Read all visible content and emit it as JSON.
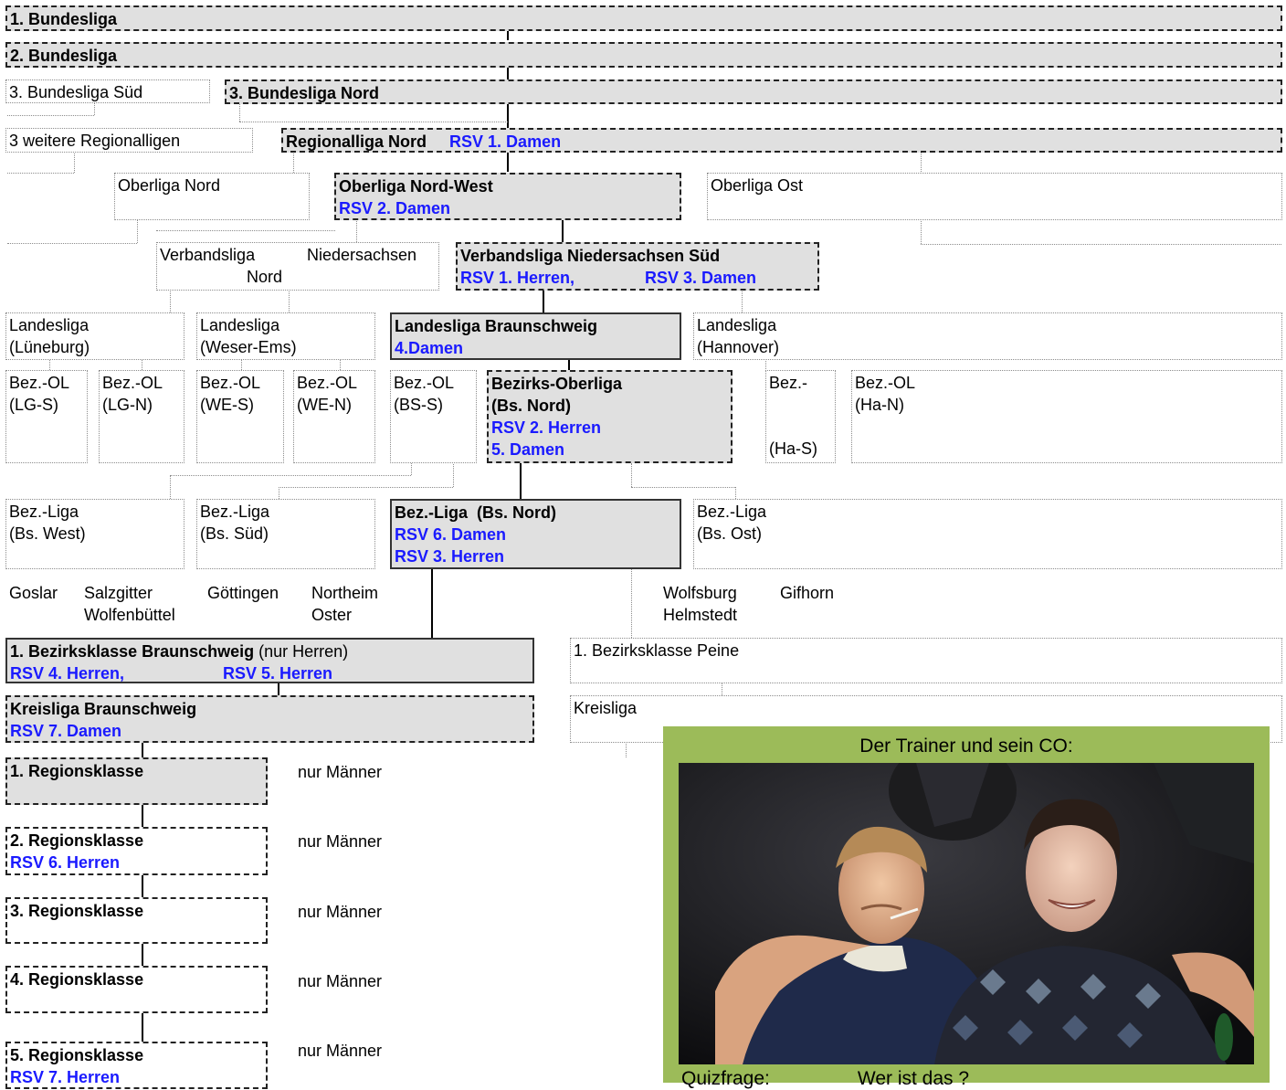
{
  "leagues": {
    "bl1": "1. Bundesliga",
    "bl2": "2. Bundesliga",
    "bl3_sued": "3. Bundesliga Süd",
    "bl3_nord": "3. Bundesliga Nord",
    "regional_others": "3 weitere Regionalligen",
    "regional_nord": "Regionalliga Nord",
    "regional_nord_team": "RSV 1. Damen",
    "oberliga_nord": "Oberliga Nord",
    "oberliga_nw": "Oberliga Nord-West",
    "oberliga_nw_team": "RSV 2. Damen",
    "oberliga_ost": "Oberliga Ost",
    "vl_nord_1": "Verbandsliga",
    "vl_nord_2": "Niedersachsen",
    "vl_nord_3": "Nord",
    "vl_sued": "Verbandsliga Niedersachsen Süd",
    "vl_sued_team1": "RSV 1. Herren,",
    "vl_sued_team2": "RSV 3. Damen",
    "ll_lg_1": "Landesliga",
    "ll_lg_2": "(Lüneburg)",
    "ll_we_1": "Landesliga",
    "ll_we_2": "(Weser-Ems)",
    "ll_bs": "Landesliga Braunschweig",
    "ll_bs_team": "4.Damen",
    "ll_ha_1": "Landesliga",
    "ll_ha_2": "(Hannover)",
    "bezol_lgs_1": "Bez.-OL",
    "bezol_lgs_2": "(LG-S)",
    "bezol_lgn_1": "Bez.-OL",
    "bezol_lgn_2": "(LG-N)",
    "bezol_wes_1": "Bez.-OL",
    "bezol_wes_2": "(WE-S)",
    "bezol_wen_1": "Bez.-OL",
    "bezol_wen_2": "(WE-N)",
    "bezol_bss_1": "Bez.-OL",
    "bezol_bss_2": "(BS-S)",
    "bezol_bsn_1": "Bezirks-Oberliga",
    "bezol_bsn_2": "(Bs. Nord)",
    "bezol_bsn_team1": "RSV 2. Herren",
    "bezol_bsn_team2": "5. Damen",
    "bezol_has_1": "Bez.-",
    "bezol_has_2": "(Ha-S)",
    "bezol_han_1": "Bez.-OL",
    "bezol_han_2": "(Ha-N)",
    "bzl_west_1": "Bez.-Liga",
    "bzl_west_2": "(Bs. West)",
    "bzl_sued_1": "Bez.-Liga",
    "bzl_sued_2": "(Bs. Süd)",
    "bzl_nord": "Bez.-Liga  (Bs. Nord)",
    "bzl_nord_team1": "RSV 6. Damen",
    "bzl_nord_team2": "RSV 3. Herren",
    "bzl_ost_1": "Bez.-Liga",
    "bzl_ost_2": "(Bs. Ost)",
    "bzk_bs": "1. Bezirksklasse Braunschweig",
    "bzk_bs_note": " (nur Herren)",
    "bzk_bs_team1": "RSV 4. Herren,",
    "bzk_bs_team2": "RSV 5. Herren",
    "bzk_peine": "1. Bezirksklasse Peine",
    "kl_bs": "Kreisliga Braunschweig",
    "kl_bs_team": "RSV 7. Damen",
    "kl_other": "Kreisliga",
    "rk1": "1. Regionsklasse",
    "rk2": "2. Regionsklasse",
    "rk2_team": "RSV 6. Herren",
    "rk3": "3. Regionsklasse",
    "rk4": "4. Regionsklasse",
    "rk5": "5. Regionsklasse",
    "rk5_team": "RSV 7. Herren",
    "nur_maenner": "nur Männer"
  },
  "districts": {
    "goslar": "Goslar",
    "salzgitter": "Salzgitter",
    "wolfenbuettel": "Wolfenbüttel",
    "goettingen": "Göttingen",
    "northeim": "Northeim",
    "oster": "Oster",
    "wolfsburg": "Wolfsburg",
    "helmstedt": "Helmstedt",
    "gifhorn": "Gifhorn"
  },
  "photo": {
    "caption": "Der Trainer und sein CO:",
    "quiz_label": "Quizfrage:",
    "quiz_question": "Wer ist das ?"
  },
  "colors": {
    "highlight_fill": "#e0e0e0",
    "team_text": "#1a1aff",
    "photo_frame": "#9cbb59"
  }
}
